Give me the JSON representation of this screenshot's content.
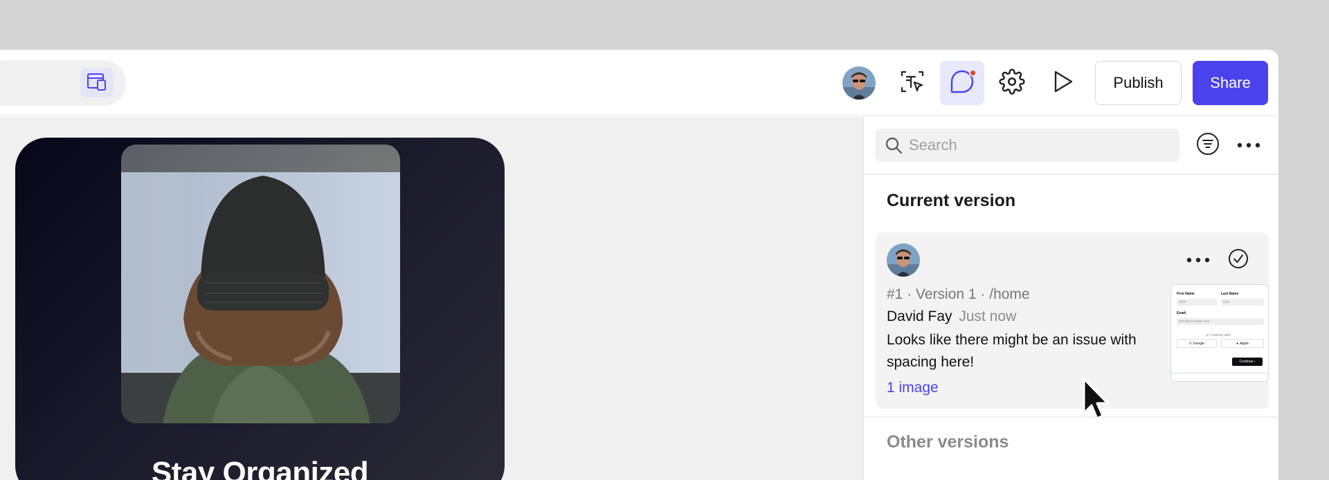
{
  "toolbar": {
    "publish_label": "Publish",
    "share_label": "Share",
    "icons": [
      "device-preview-icon",
      "inspect-icon",
      "comment-icon",
      "settings-icon",
      "play-icon"
    ],
    "accent_color": "#4a42ec",
    "notification_color": "#ec4324"
  },
  "canvas": {
    "screen_title": "Stay Organized"
  },
  "panel": {
    "search_placeholder": "Search",
    "current_section": "Current version",
    "other_section": "Other versions",
    "version_card": {
      "meta": "#1 · Version 1 · /home",
      "author": "David Fay",
      "time": "Just now",
      "comment": "Looks like there might be an issue with spacing here!",
      "attachment_link": "1 image",
      "thumbnail": {
        "first_name_label": "First Name",
        "first_name_value": "John",
        "last_name_label": "Last Name",
        "last_name_value": "Doe",
        "email_label": "Email",
        "email_value": "john@example.com",
        "or_continue": "or continue with",
        "google_label": "Google",
        "apple_label": "Apple",
        "continue_label": "Continue"
      }
    }
  }
}
